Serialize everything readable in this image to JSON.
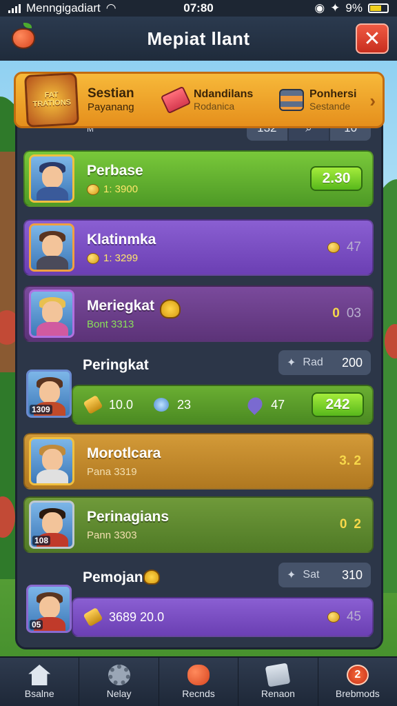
{
  "status_bar": {
    "carrier": "Menngigadiart",
    "time": "07:80",
    "battery": "9%"
  },
  "header": {
    "title": "Mepiat llant"
  },
  "banner": {
    "badge_text": "FAT TRATIONS",
    "season_title": "Sestian",
    "season_sub": "Payanang",
    "item1_title": "Ndandilans",
    "item1_sub": "Rodanica",
    "item2_title": "Ponhersi",
    "item2_sub": "Sestande"
  },
  "filters": {
    "mini_label": "M",
    "left": "132",
    "right": "10"
  },
  "rows": [
    {
      "name": "Perbase",
      "sub": "1: 3900",
      "score": "2.30"
    },
    {
      "name": "Klatinmka",
      "sub": "1: 3299",
      "score_muted": "47"
    },
    {
      "name": "Meriegkat",
      "sub": "Bont 3313",
      "score": "0",
      "score_muted": "03"
    },
    {
      "name": "Morotlcara",
      "sub": "Pana 3319",
      "score": "3. 2"
    },
    {
      "name": "Perinagians",
      "sub": "Pann 3303",
      "score": "0",
      "score2": "2"
    }
  ],
  "section1": {
    "title": "Peringkat",
    "pill_label": "Rad",
    "pill_value": "200",
    "avatar_tag": "1309",
    "stat1": "10.0",
    "stat2": "23",
    "stat3": "47",
    "score": "242"
  },
  "section2": {
    "title": "Pemojan",
    "pill_label": "Sat",
    "pill_value": "310",
    "avatar_tag": "05",
    "stat1": "3689 20.0",
    "score_muted": "45"
  },
  "avatar_tags": {
    "r5": "108"
  },
  "nav": [
    {
      "label": "Bsalne"
    },
    {
      "label": "Nelay"
    },
    {
      "label": "Recnds"
    },
    {
      "label": "Renaon"
    },
    {
      "label": "Brebmods",
      "badge": "2"
    }
  ]
}
